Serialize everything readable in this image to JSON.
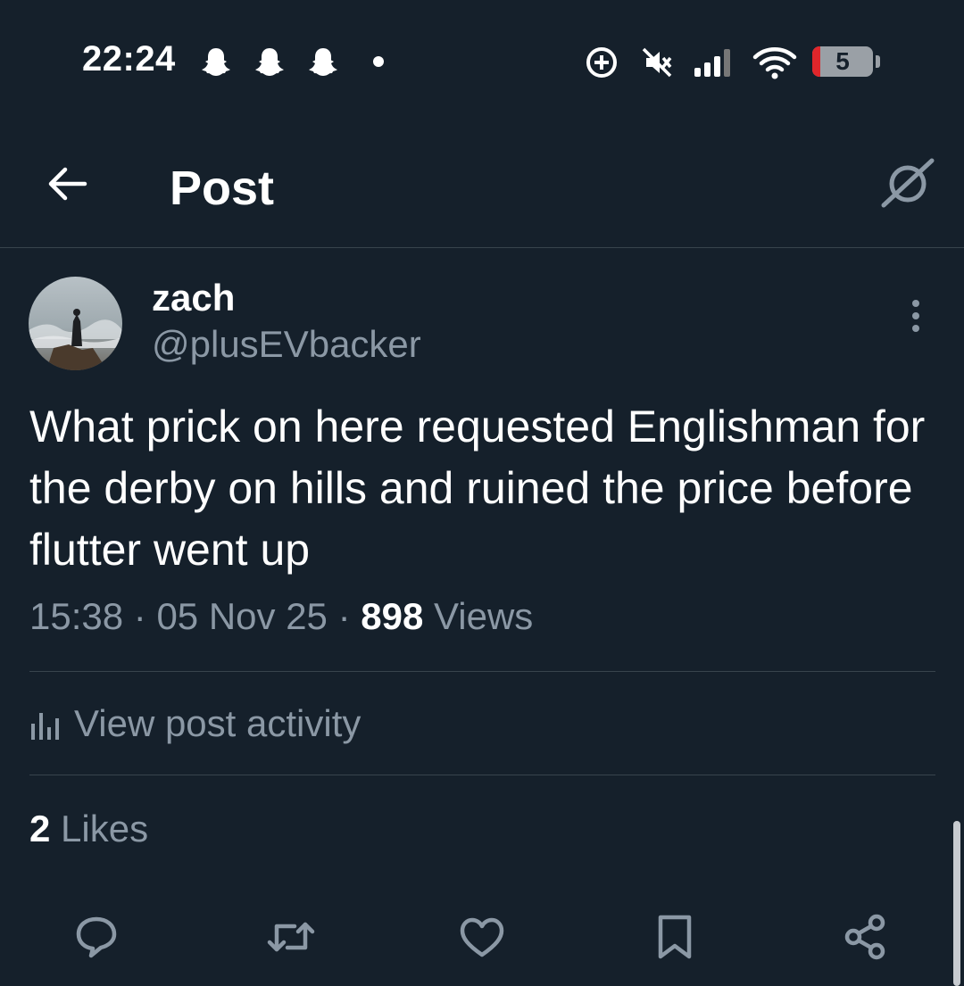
{
  "status_bar": {
    "time": "22:24",
    "battery_level": "5",
    "icons": [
      "snapchat-ghost-icon",
      "snapchat-ghost-icon",
      "snapchat-ghost-icon",
      "notification-dot-icon",
      "data-saver-icon",
      "mute-icon",
      "signal-icon",
      "wifi-icon",
      "battery-icon"
    ]
  },
  "header": {
    "title": "Post",
    "back_icon": "arrow-left-icon",
    "grok_icon": "grok-icon"
  },
  "post": {
    "author_name": "zach",
    "author_handle": "@plusEVbacker",
    "text": "What prick on here requested Englishman for the derby on hills and ruined the price before flutter went up",
    "time": "15:38",
    "date": "05 Nov 25",
    "views_count": "898",
    "views_label": "Views",
    "separator": "·",
    "activity_label": "View post activity",
    "likes_count": "2",
    "likes_label": "Likes"
  },
  "actions": [
    "reply-icon",
    "repost-icon",
    "like-icon",
    "bookmark-icon",
    "share-icon"
  ],
  "colors": {
    "background": "#15202b",
    "secondary_text": "#8b98a5",
    "divider": "#38444d",
    "battery_low": "#e0262b"
  }
}
